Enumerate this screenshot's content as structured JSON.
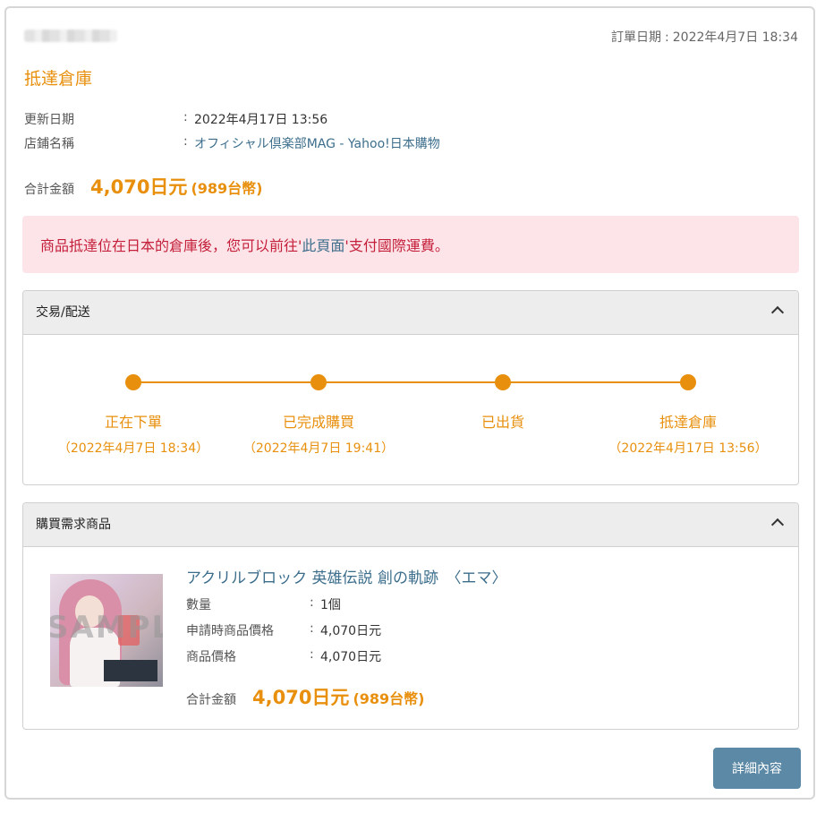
{
  "order": {
    "date_label": "訂單日期",
    "date_value": "2022年4月7日 18:34"
  },
  "status_title": "抵達倉庫",
  "info": [
    {
      "label": "更新日期",
      "value": "2022年4月17日 13:56"
    },
    {
      "label": "店鋪名稱",
      "value": "オフィシャル倶楽部MAG - Yahoo!日本購物"
    }
  ],
  "total": {
    "label": "合計金額",
    "amount": "4,070日元",
    "twd": "(989台幣)"
  },
  "alert": {
    "before": "商品抵達位在日本的倉庫後，您可以前往'",
    "link": "此頁面",
    "after": "'支付國際運費。"
  },
  "shipping_panel": {
    "title": "交易/配送",
    "steps": [
      {
        "label": "正在下單",
        "date": "（2022年4月7日 18:34）"
      },
      {
        "label": "已完成購買",
        "date": "（2022年4月7日 19:41）"
      },
      {
        "label": "已出貨",
        "date": ""
      },
      {
        "label": "抵達倉庫",
        "date": "（2022年4月17日 13:56）"
      }
    ]
  },
  "product_panel": {
    "title": "購買需求商品",
    "image_watermark": "SAMPLE",
    "product_name": "アクリルブロック 英雄伝説 創の軌跡　〈エマ〉",
    "rows": [
      {
        "label": "數量",
        "value": "1個"
      },
      {
        "label": "申請時商品價格",
        "value": "4,070日元"
      },
      {
        "label": "商品價格",
        "value": "4,070日元"
      }
    ],
    "total_label": "合計金額",
    "total_amount": "4,070日元",
    "total_twd": "(989台幣)"
  },
  "detail_button": "詳細內容",
  "colors": {
    "accent": "#e8900d",
    "link": "#3c6e8c",
    "alert_bg": "#fde4e8",
    "alert_text": "#c41f3a",
    "button": "#5b89a6"
  }
}
